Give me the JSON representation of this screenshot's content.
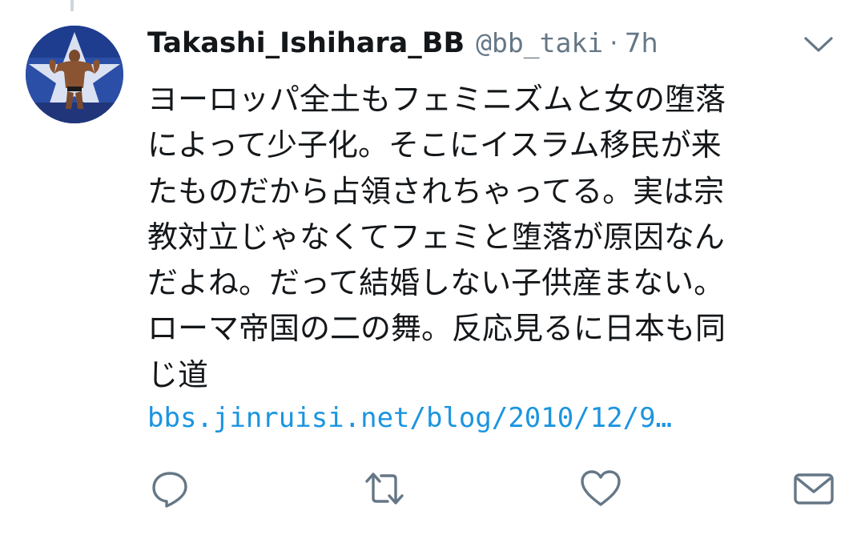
{
  "tweet": {
    "display_name": "Takashi_Ishihara_BB",
    "handle": "@bb_taki",
    "separator": "·",
    "time": "7h",
    "text": "ヨーロッパ全土もフェミニズムと女の堕落\nによって少子化。そこにイスラム移民が来\nたものだから占領されちゃってる。実は宗\n教対立じゃなくてフェミと堕落が原因なん\nだよね。だって結婚しない子供産まない。\nローマ帝国の二の舞。反応見るに日本も同\nじ道",
    "link": "bbs.jinruisi.net/blog/2010/12/9…"
  },
  "icons": {
    "caret": "chevron-down-icon",
    "reply": "reply-icon",
    "retweet": "retweet-icon",
    "like": "heart-icon",
    "share": "mail-icon"
  },
  "colors": {
    "primary_text": "#14171a",
    "secondary_text": "#657786",
    "link": "#1b95e0",
    "icon": "#657786"
  }
}
